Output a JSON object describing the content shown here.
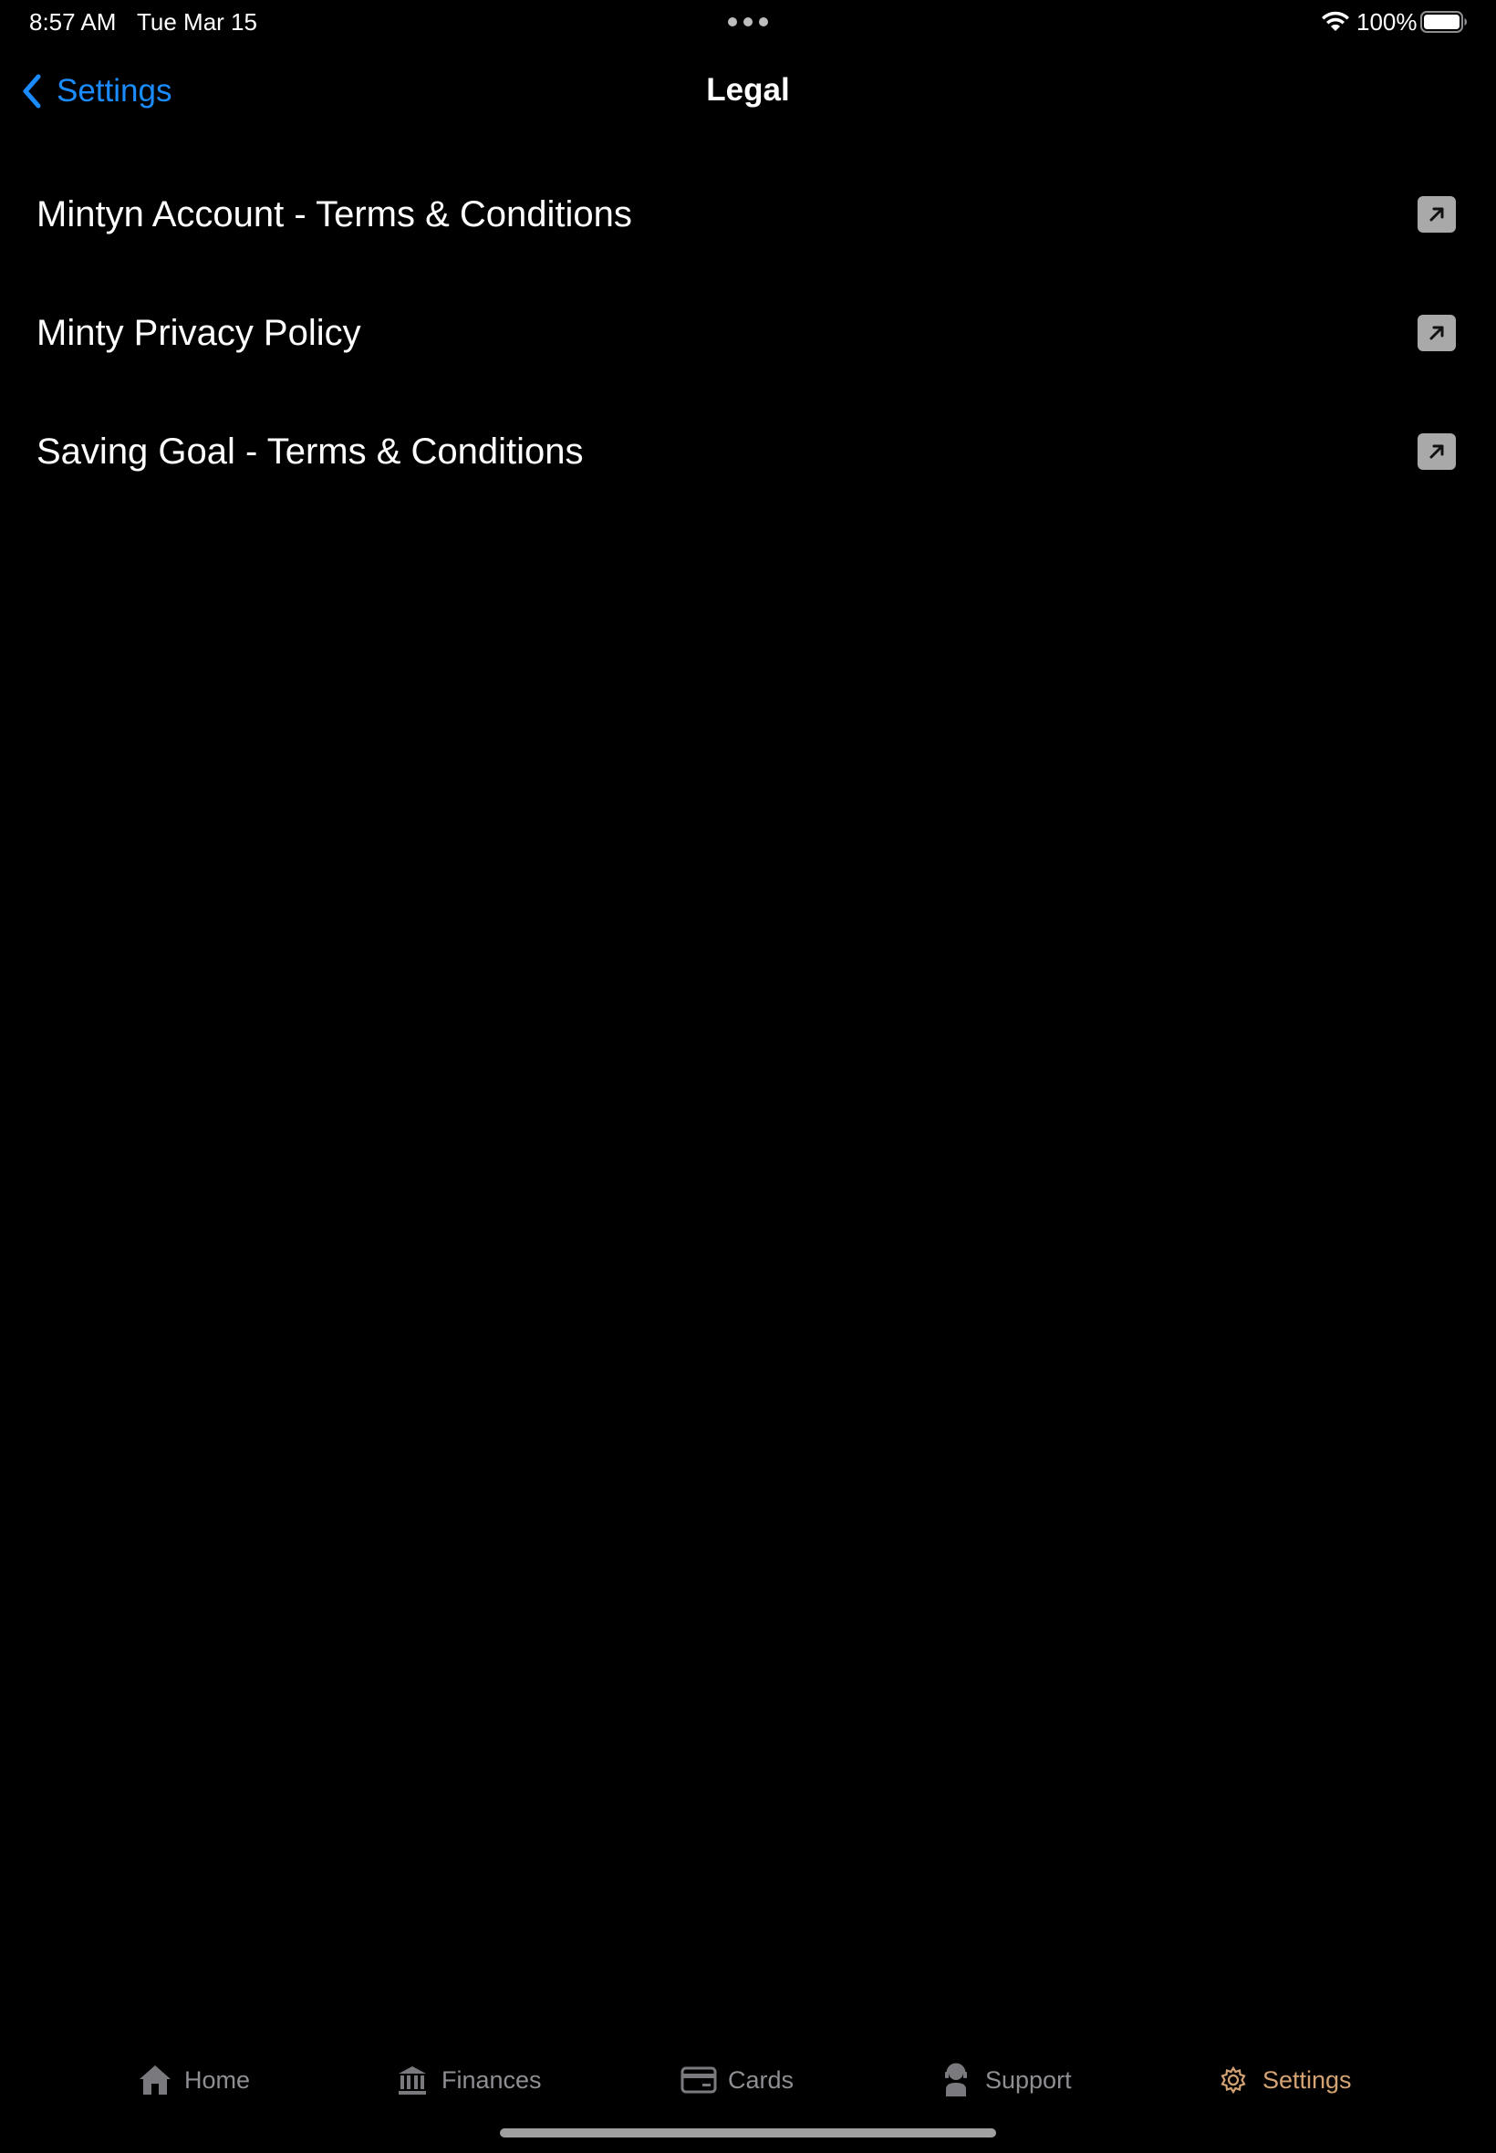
{
  "status_bar": {
    "time": "8:57 AM",
    "date": "Tue Mar 15",
    "battery_percent": "100%",
    "battery_level": 1.0
  },
  "nav": {
    "back_label": "Settings",
    "title": "Legal"
  },
  "legal_items": [
    {
      "label": "Mintyn Account - Terms & Conditions",
      "icon": "external-link-icon"
    },
    {
      "label": "Minty Privacy Policy",
      "icon": "external-link-icon"
    },
    {
      "label": "Saving Goal - Terms & Conditions",
      "icon": "external-link-icon"
    }
  ],
  "tab_bar": {
    "tabs": [
      {
        "label": "Home",
        "icon": "home-icon",
        "active": false
      },
      {
        "label": "Finances",
        "icon": "bank-icon",
        "active": false
      },
      {
        "label": "Cards",
        "icon": "card-icon",
        "active": false
      },
      {
        "label": "Support",
        "icon": "support-agent-icon",
        "active": false
      },
      {
        "label": "Settings",
        "icon": "gear-icon",
        "active": true
      }
    ]
  },
  "colors": {
    "background": "#000000",
    "accent_blue": "#1a8cff",
    "active_tab": "#d4a373",
    "inactive_tab": "#8e8e93",
    "link_icon_bg": "#a9a9a9"
  }
}
